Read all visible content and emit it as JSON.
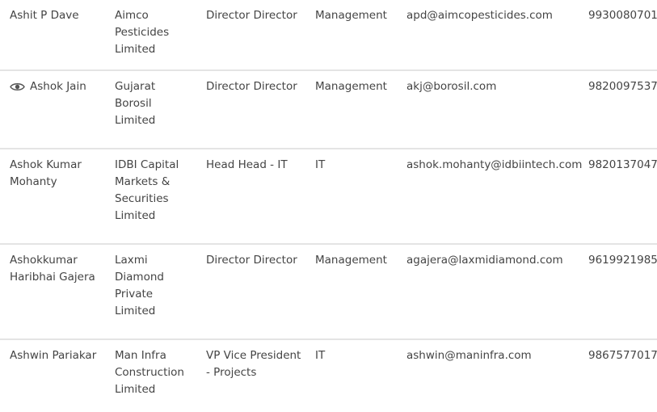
{
  "rows": [
    {
      "name_lines": [
        "Ashit P Dave"
      ],
      "has_icon": false,
      "company_lines": [
        "Aimco",
        "Pesticides",
        "Limited"
      ],
      "designation_lines": [
        "Director Director"
      ],
      "department": "Management",
      "email": "apd@aimcopesticides.com",
      "phone": "9930080701"
    },
    {
      "name_lines": [
        "Ashok Jain"
      ],
      "has_icon": true,
      "icon": "eye-icon",
      "company_lines": [
        "Gujarat",
        "Borosil",
        "Limited"
      ],
      "designation_lines": [
        "Director Director"
      ],
      "department": "Management",
      "email": "akj@borosil.com",
      "phone": "9820097537"
    },
    {
      "name_lines": [
        "Ashok Kumar",
        "Mohanty"
      ],
      "has_icon": false,
      "company_lines": [
        "IDBI Capital",
        "Markets &",
        "Securities",
        "Limited"
      ],
      "designation_lines": [
        "Head Head - IT"
      ],
      "department": "IT",
      "email": "ashok.mohanty@idbiintech.com",
      "phone": "9820137047"
    },
    {
      "name_lines": [
        "Ashokkumar",
        "Haribhai Gajera"
      ],
      "has_icon": false,
      "company_lines": [
        "Laxmi",
        "Diamond",
        "Private",
        "Limited"
      ],
      "designation_lines": [
        "Director Director"
      ],
      "department": "Management",
      "email": "agajera@laxmidiamond.com",
      "phone": "9619921985"
    },
    {
      "name_lines": [
        "Ashwin Pariakar"
      ],
      "has_icon": false,
      "company_lines": [
        "Man Infra",
        "Construction",
        "Limited"
      ],
      "designation_lines": [
        "VP Vice President",
        "- Projects"
      ],
      "department": "IT",
      "email": "ashwin@maninfra.com",
      "phone": "9867577017"
    }
  ]
}
